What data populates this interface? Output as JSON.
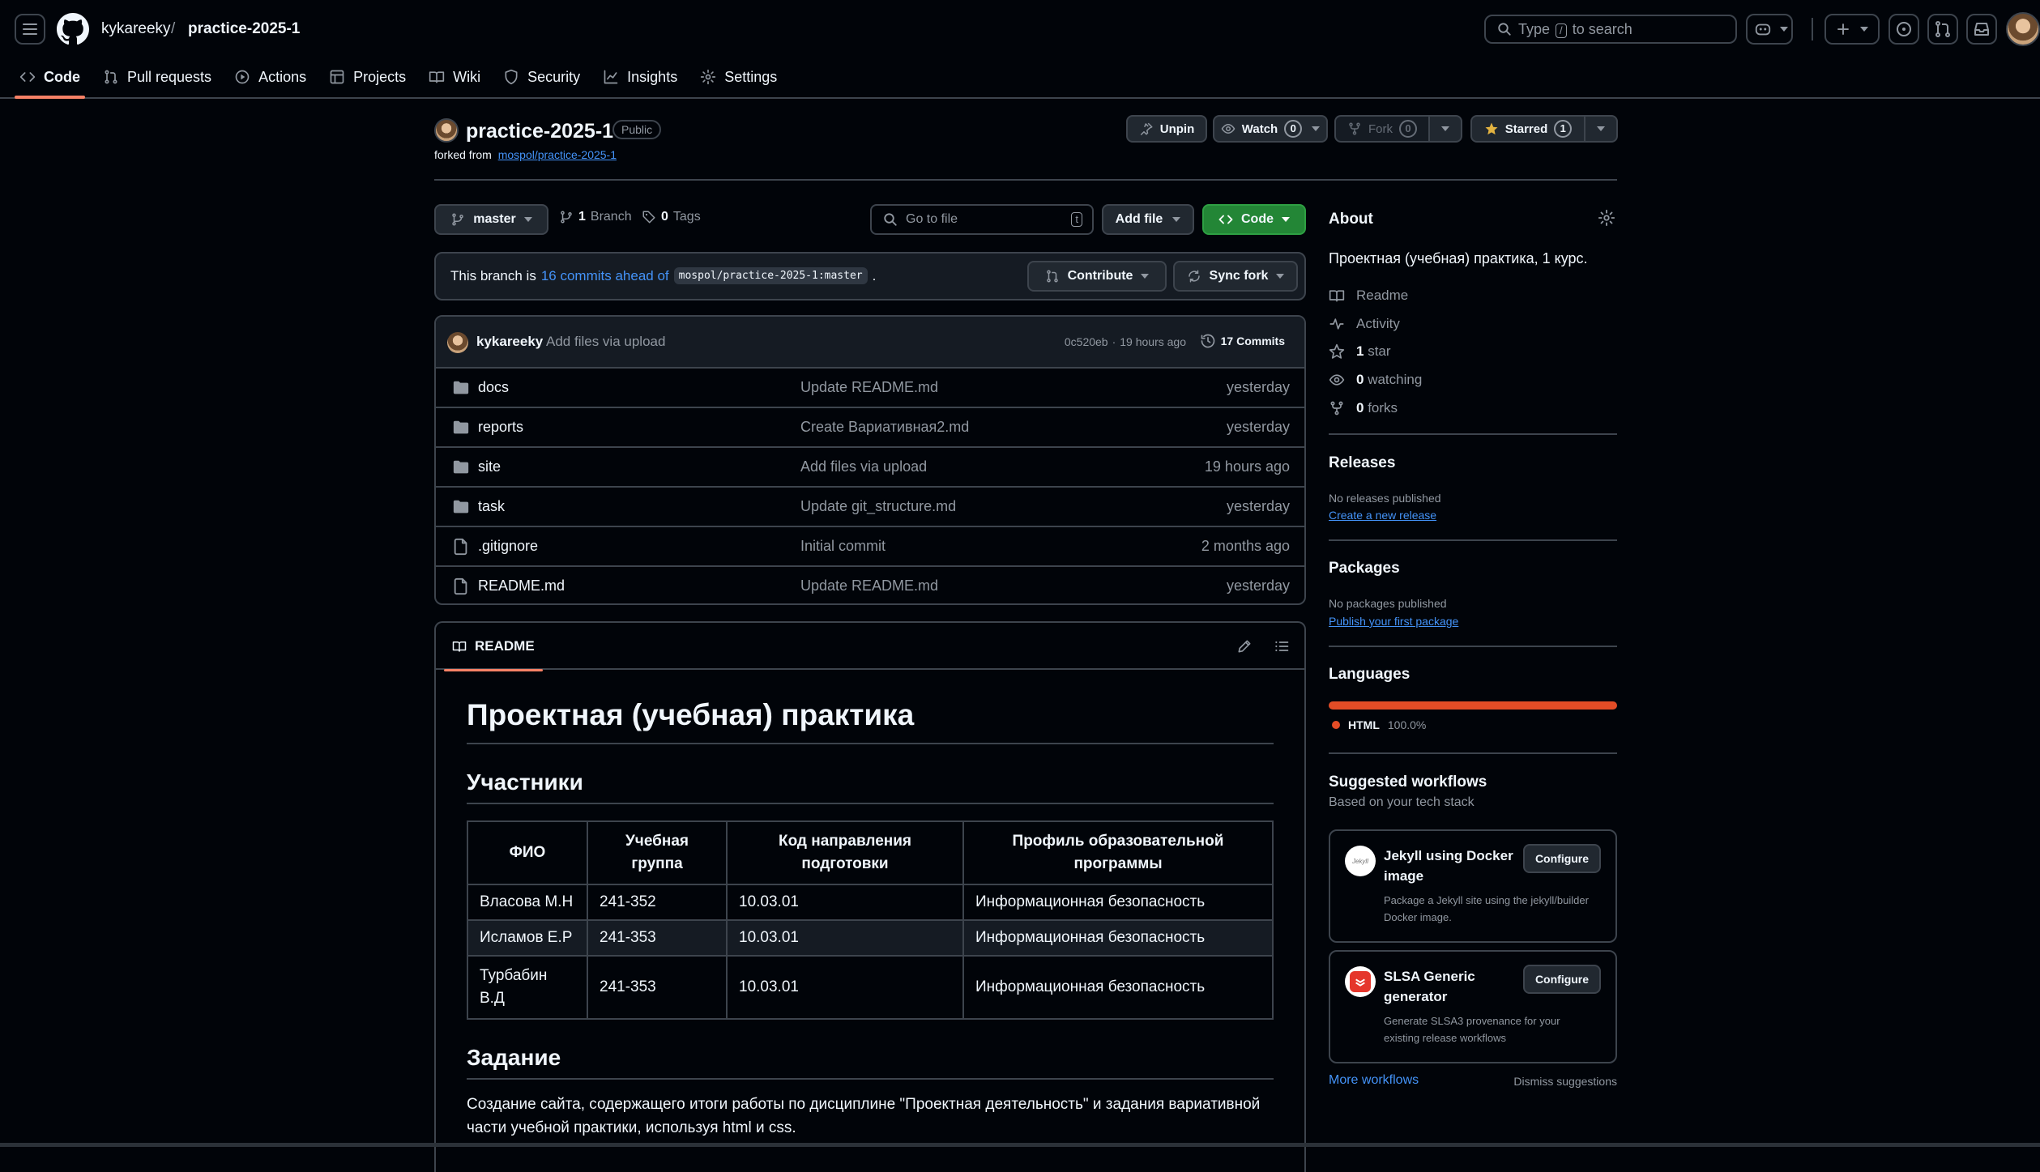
{
  "header": {
    "owner": "kykareeky",
    "separator": "/",
    "repo": "practice-2025-1",
    "search_before": "Type",
    "search_key": "/",
    "search_after": "to search"
  },
  "tabs": [
    {
      "label": "Code"
    },
    {
      "label": "Pull requests"
    },
    {
      "label": "Actions"
    },
    {
      "label": "Projects"
    },
    {
      "label": "Wiki"
    },
    {
      "label": "Security"
    },
    {
      "label": "Insights"
    },
    {
      "label": "Settings"
    }
  ],
  "repo": {
    "name": "practice-2025-1",
    "visibility": "Public",
    "forked_prefix": "forked from",
    "forked_source": "mospol/practice-2025-1",
    "unpin": "Unpin",
    "watch": "Watch",
    "watch_count": "0",
    "fork": "Fork",
    "fork_count": "0",
    "starred": "Starred",
    "star_count": "1"
  },
  "toolbar": {
    "branch": "master",
    "branches_count": "1",
    "branches_label": "Branch",
    "tags_count": "0",
    "tags_label": "Tags",
    "goto_placeholder": "Go to file",
    "goto_key": "t",
    "add_file": "Add file",
    "code": "Code"
  },
  "branch_info": {
    "prefix": "This branch is",
    "ahead": "16 commits ahead of",
    "ref": "mospol/practice-2025-1:master",
    "suffix": ".",
    "contribute": "Contribute",
    "sync": "Sync fork"
  },
  "commit": {
    "author": "kykareeky",
    "message": "Add files via upload",
    "hash": "0c520eb",
    "dot": "·",
    "time": "19 hours ago",
    "commits": "17 Commits"
  },
  "files": [
    {
      "name": "docs",
      "type": "folder",
      "message": "Update README.md",
      "date": "yesterday"
    },
    {
      "name": "reports",
      "type": "folder",
      "message": "Create Вариативная2.md",
      "date": "yesterday"
    },
    {
      "name": "site",
      "type": "folder",
      "message": "Add files via upload",
      "date": "19 hours ago"
    },
    {
      "name": "task",
      "type": "folder",
      "message": "Update git_structure.md",
      "date": "yesterday"
    },
    {
      "name": ".gitignore",
      "type": "file",
      "message": "Initial commit",
      "date": "2 months ago"
    },
    {
      "name": "README.md",
      "type": "file",
      "message": "Update README.md",
      "date": "yesterday"
    }
  ],
  "readme": {
    "tab": "README",
    "h1": "Проектная (учебная) практика",
    "h2_members": "Участники",
    "table": {
      "headers": [
        "ФИО",
        "Учебная группа",
        "Код направления подготовки",
        "Профиль образовательной программы"
      ],
      "rows": [
        [
          "Власова М.Н",
          "241-352",
          "10.03.01",
          "Информационная безопасность"
        ],
        [
          "Исламов Е.Р",
          "241-353",
          "10.03.01",
          "Информационная безопасность"
        ],
        [
          "Турбабин В.Д",
          "241-353",
          "10.03.01",
          "Информационная безопасность"
        ]
      ]
    },
    "h2_task": "Задание",
    "task_text": "Создание сайта, содержащего итоги работы по дисциплине \"Проектная деятельность\" и задания вариативной части учебной практики, используя html и css."
  },
  "sidebar": {
    "about_title": "About",
    "description": "Проектная (учебная) практика, 1 курс.",
    "readme": "Readme",
    "activity": "Activity",
    "stars_count": "1",
    "stars_label": "star",
    "watching_count": "0",
    "watching_label": "watching",
    "forks_count": "0",
    "forks_label": "forks",
    "releases_title": "Releases",
    "no_releases": "No releases published",
    "create_release": "Create a new release",
    "packages_title": "Packages",
    "no_packages": "No packages published",
    "publish_package": "Publish your first package",
    "languages_title": "Languages",
    "lang_name": "HTML",
    "lang_pct": "100.0%",
    "lang_color": "#e34c26",
    "lang_fraction": 1.0,
    "suggested_title": "Suggested workflows",
    "suggested_sub": "Based on your tech stack",
    "workflows": [
      {
        "title": "Jekyll using Docker image",
        "desc": "Package a Jekyll site using the jekyll/builder Docker image.",
        "button": "Configure",
        "logo_text": "Jekyll"
      },
      {
        "title": "SLSA Generic generator",
        "desc": "Generate SLSA3 provenance for your existing release workflows",
        "button": "Configure"
      }
    ],
    "more_workflows": "More workflows",
    "dismiss": "Dismiss suggestions"
  },
  "colors": {
    "accent_green": "#238636",
    "link_blue": "#4493f8",
    "tab_underline": "#f78166",
    "star_yellow": "#e3b341"
  }
}
